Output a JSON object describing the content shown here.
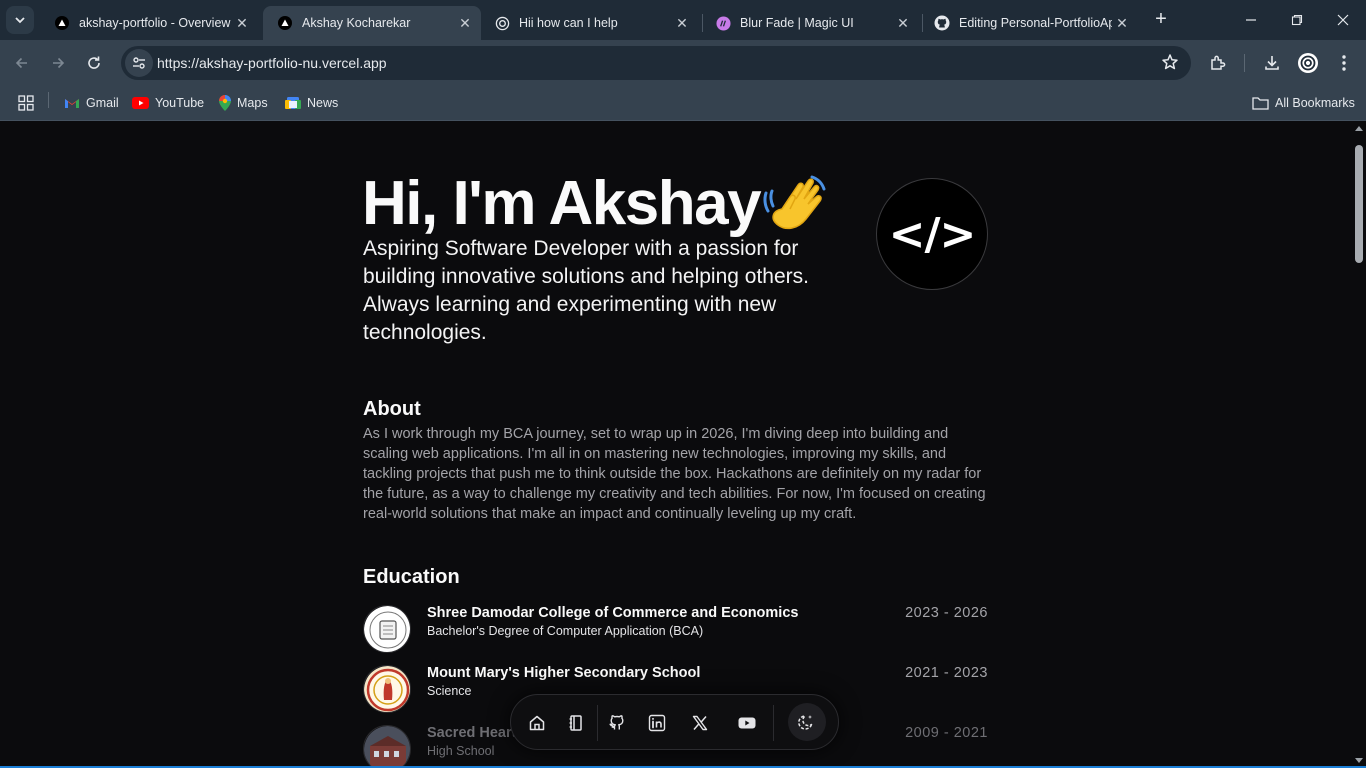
{
  "browser": {
    "tabs": [
      {
        "title": "akshay-portfolio - Overview",
        "icon": "vercel-icon"
      },
      {
        "title": "Akshay Kocharekar",
        "icon": "vercel-icon",
        "active": true
      },
      {
        "title": "Hii how can I help",
        "icon": "chatgpt-icon"
      },
      {
        "title": "Blur Fade | Magic UI",
        "icon": "magicui-icon"
      },
      {
        "title": "Editing Personal-PortfolioAp",
        "icon": "github-icon"
      }
    ],
    "url": "https://akshay-portfolio-nu.vercel.app",
    "bookmarks": [
      {
        "label": "Gmail",
        "icon": "gmail-icon"
      },
      {
        "label": "YouTube",
        "icon": "youtube-icon"
      },
      {
        "label": "Maps",
        "icon": "maps-icon"
      },
      {
        "label": "News",
        "icon": "news-icon"
      }
    ],
    "all_bookmarks": "All Bookmarks"
  },
  "hero": {
    "title": "Hi, I'm Akshay",
    "emoji": "👋",
    "subtitle": "Aspiring Software Developer with a passion for building innovative solutions and helping others. Always learning and experimenting with new technologies.",
    "avatar_text": "</>"
  },
  "about": {
    "heading": "About",
    "text": "As I work through my BCA journey, set to wrap up in 2026, I'm diving deep into building and scaling web applications. I'm all in on mastering new technologies, improving my skills, and tackling projects that push me to think outside the box. Hackathons are definitely on my radar for the future, as a way to challenge my creativity and tech abilities. For now, I'm focused on creating real-world solutions that make an impact and continually leveling up my craft."
  },
  "education": {
    "heading": "Education",
    "items": [
      {
        "school": "Shree Damodar College of Commerce and Economics",
        "degree": "Bachelor's Degree of Computer Application (BCA)",
        "years": "2023 - 2026"
      },
      {
        "school": "Mount Mary's Higher Secondary School",
        "degree": "Science",
        "years": "2021 - 2023"
      },
      {
        "school": "Sacred Heart",
        "degree": "High School",
        "years": "2009 - 2021"
      }
    ]
  },
  "dock": {
    "items": [
      "home-icon",
      "notebook-icon",
      "github-icon",
      "linkedin-icon",
      "x-icon",
      "youtube-icon",
      "theme-toggle-icon"
    ]
  },
  "colors": {
    "background": "#0b0b0d",
    "tabbar": "#1f2b37",
    "toolbar": "#35424f",
    "text_primary": "#fafafa",
    "text_muted": "#a3a3a8"
  }
}
